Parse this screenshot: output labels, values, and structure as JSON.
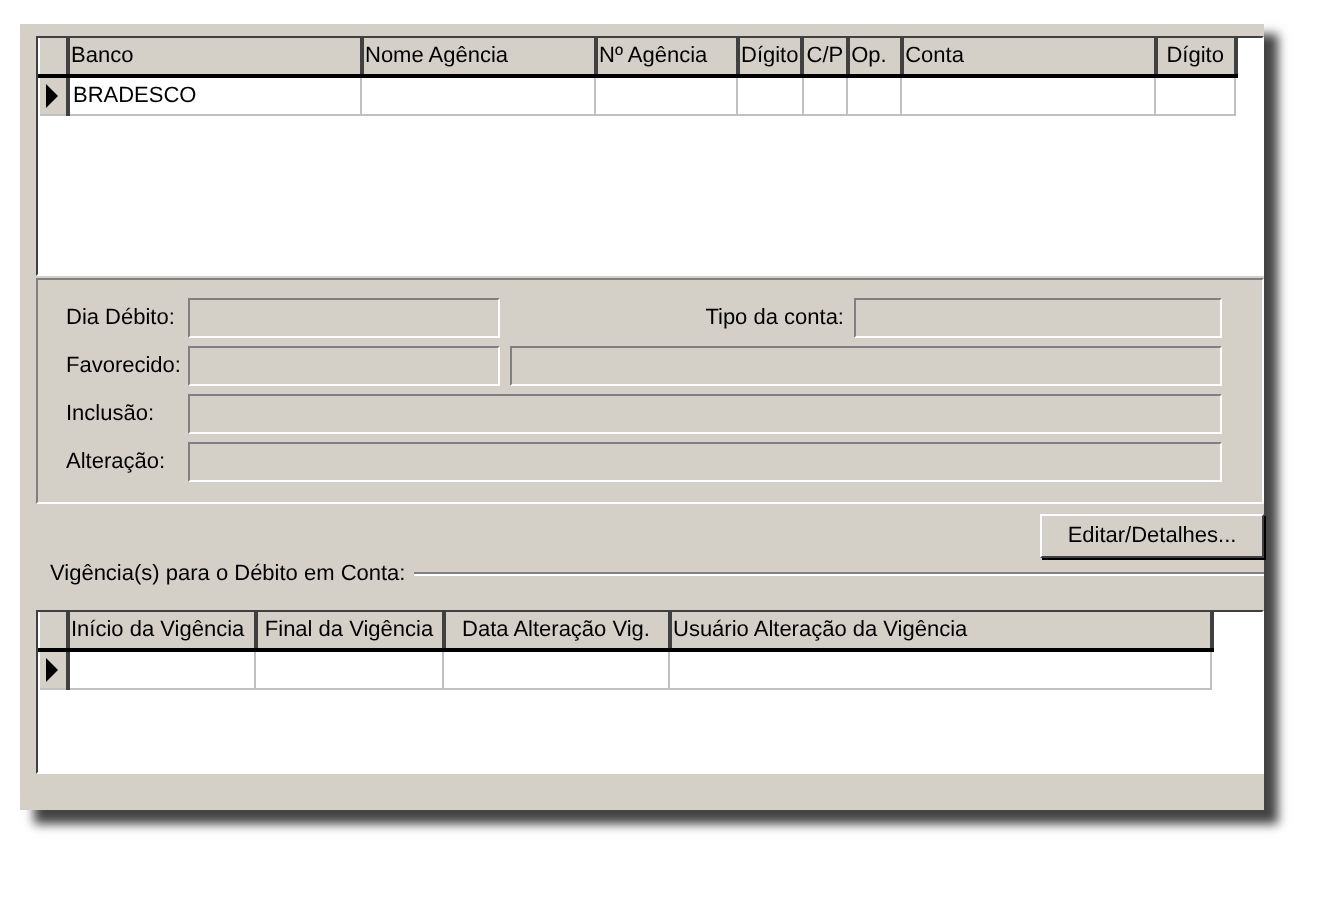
{
  "accounts_table": {
    "columns": [
      "Banco",
      "Nome Agência",
      "Nº Agência",
      "Dígito",
      "C/P",
      "Op.",
      "Conta",
      "Dígito"
    ],
    "rows": [
      {
        "current": true,
        "cells": [
          "BRADESCO",
          "",
          "",
          "",
          "",
          "",
          "",
          ""
        ]
      }
    ]
  },
  "form": {
    "dia_debito": {
      "label": "Dia Débito:"
    },
    "tipo_conta": {
      "label": "Tipo da conta:"
    },
    "favorecido": {
      "label": "Favorecido:"
    },
    "inclusao": {
      "label": "Inclusão:"
    },
    "alteracao": {
      "label": "Alteração:"
    }
  },
  "edit_button": "Editar/Detalhes...",
  "validity_group": {
    "title": "Vigência(s) para o Débito em Conta:",
    "columns": [
      "Início da Vigência",
      "Final da Vigência",
      "Data Alteração Vig.",
      "Usuário Alteração da Vigência"
    ],
    "rows": [
      {
        "current": true,
        "cells": [
          "",
          "",
          "",
          ""
        ]
      }
    ]
  }
}
